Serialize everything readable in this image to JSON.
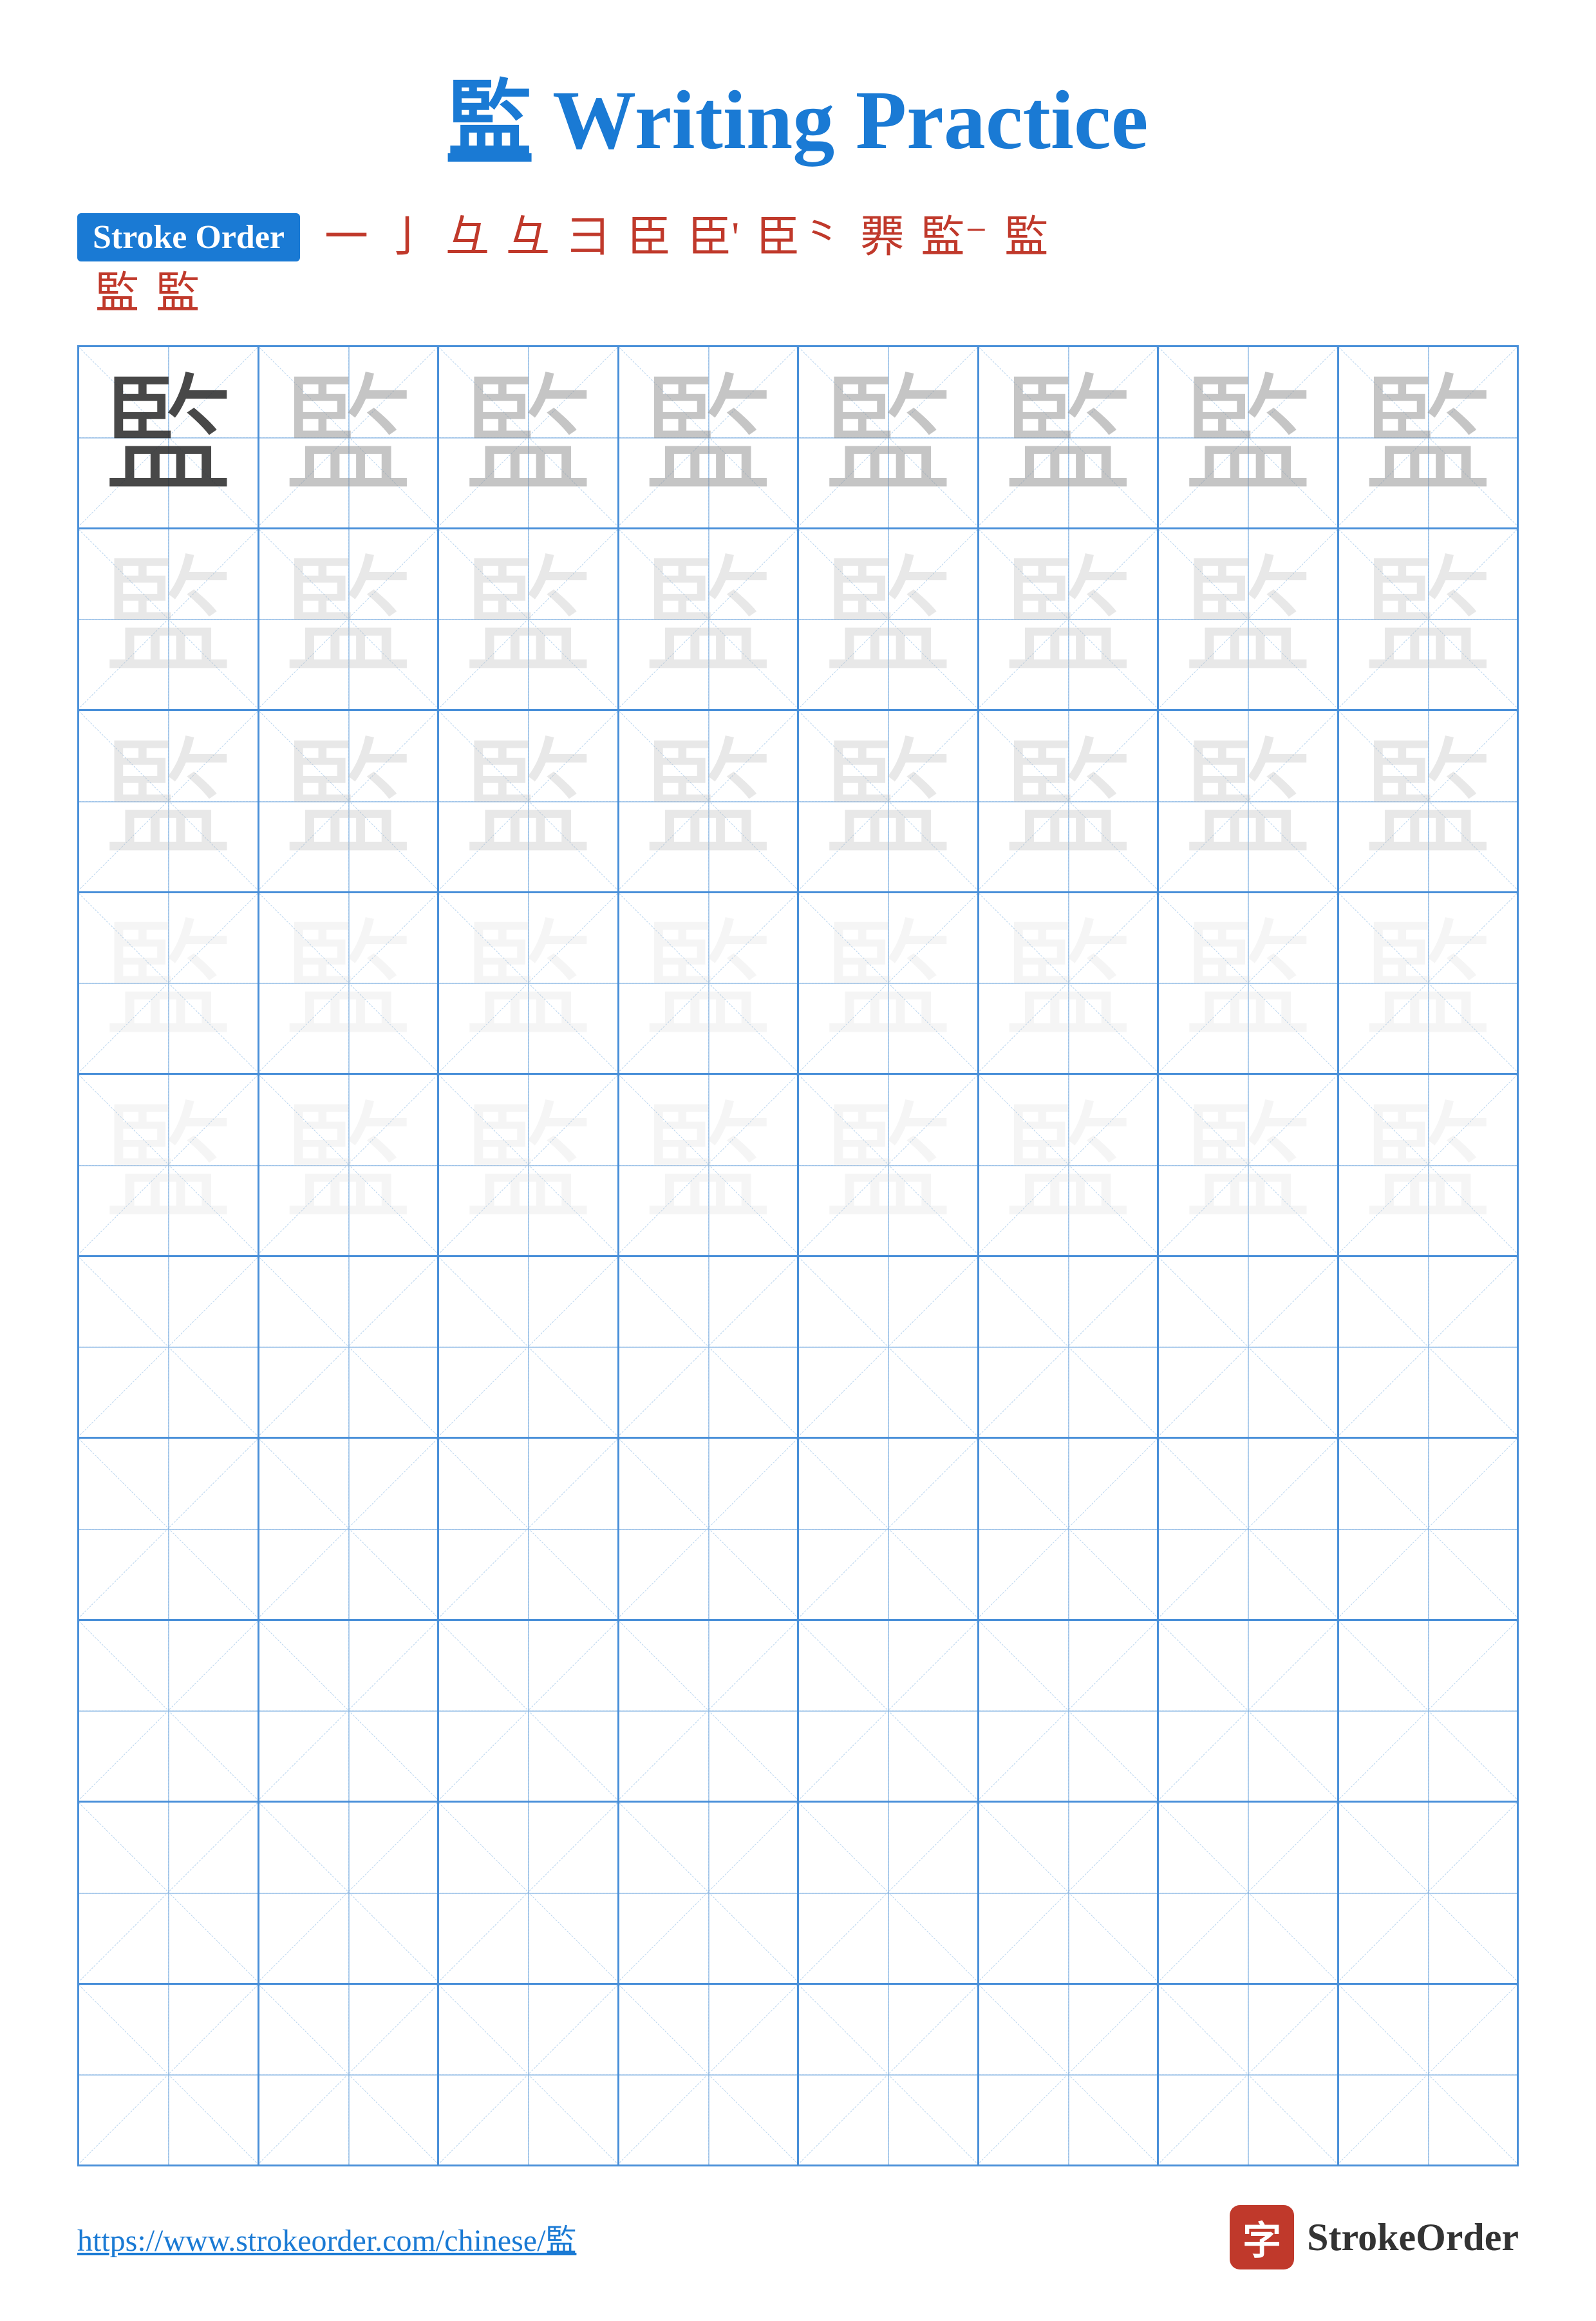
{
  "page": {
    "title": "Writing Practice",
    "character": "監",
    "title_full": "監 Writing Practice"
  },
  "stroke_order": {
    "label": "Stroke Order",
    "chars_row1": [
      "一",
      "亅",
      "⺕",
      "𠃊",
      "彐",
      "臣",
      "臣'",
      "臣⺀",
      "臣⺀⺀",
      "監⁻",
      "監"
    ],
    "chars_row2": [
      "監⁻",
      "監"
    ],
    "display_row1": [
      "一",
      "亅",
      "彑",
      "彑",
      "彐",
      "臣",
      "臣",
      "臣",
      "臣",
      "監",
      "監"
    ],
    "display_row2": [
      "監",
      "監"
    ]
  },
  "grid": {
    "rows": 10,
    "cols": 8,
    "character": "監"
  },
  "footer": {
    "url": "https://www.strokeorder.com/chinese/監",
    "brand": "StrokeOrder"
  }
}
